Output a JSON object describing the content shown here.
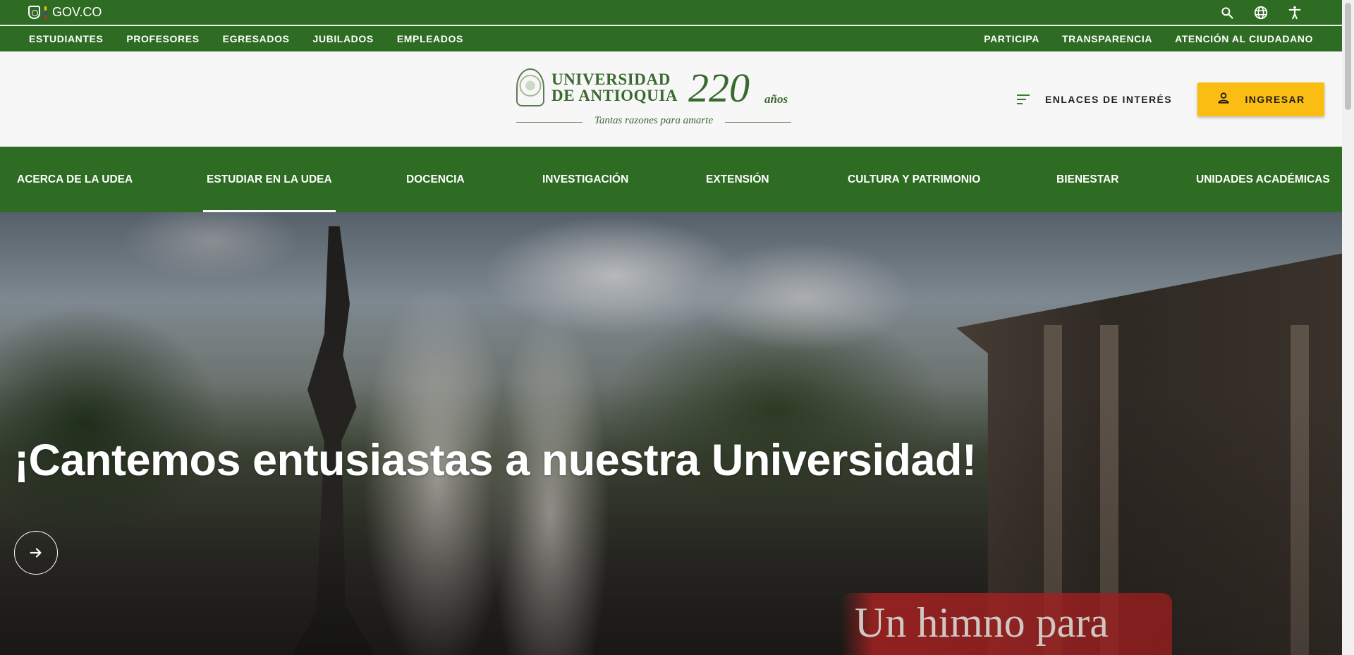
{
  "gov": {
    "logo_text": "GOV.CO",
    "icons": [
      "search-icon",
      "globe-icon",
      "accessibility-icon"
    ]
  },
  "audience_nav": {
    "left": [
      "ESTUDIANTES",
      "PROFESORES",
      "EGRESADOS",
      "JUBILADOS",
      "EMPLEADOS"
    ],
    "right": [
      "PARTICIPA",
      "TRANSPARENCIA",
      "ATENCIÓN AL CIUDADANO"
    ]
  },
  "header": {
    "logo": {
      "line1": "UNIVERSIDAD",
      "line2": "DE ANTIOQUIA",
      "anniversary_number": "220",
      "anniversary_suffix": "años",
      "tagline": "Tantas razones para amarte"
    },
    "enlaces_label": "ENLACES DE INTERÉS",
    "ingresar_label": "INGRESAR"
  },
  "main_nav": {
    "items": [
      {
        "label": "ACERCA DE LA UDEA",
        "active": false
      },
      {
        "label": "ESTUDIAR EN LA UDEA",
        "active": true
      },
      {
        "label": "DOCENCIA",
        "active": false
      },
      {
        "label": "INVESTIGACIÓN",
        "active": false
      },
      {
        "label": "EXTENSIÓN",
        "active": false
      },
      {
        "label": "CULTURA Y PATRIMONIO",
        "active": false
      },
      {
        "label": "BIENESTAR",
        "active": false
      },
      {
        "label": "UNIDADES ACADÉMICAS",
        "active": false
      }
    ]
  },
  "hero": {
    "title": "¡Cantemos entusiastas a nuestra Universidad!",
    "image_text": "Un himno para",
    "button_icon": "arrow-right-icon"
  },
  "colors": {
    "brand_green": "#2e6b23",
    "accent_yellow": "#fbbd11",
    "logo_green": "#3a6a30"
  }
}
